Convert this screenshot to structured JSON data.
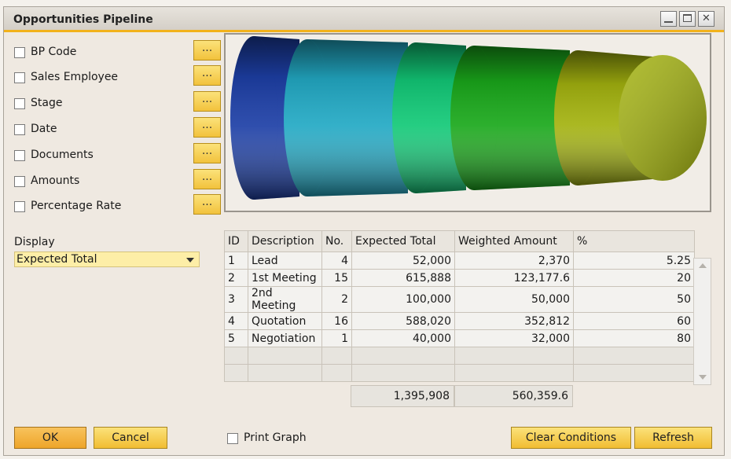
{
  "window": {
    "title": "Opportunities Pipeline"
  },
  "criteria": [
    {
      "label": "BP Code",
      "checked": false
    },
    {
      "label": "Sales Employee",
      "checked": false
    },
    {
      "label": "Stage",
      "checked": false
    },
    {
      "label": "Date",
      "checked": false
    },
    {
      "label": "Documents",
      "checked": false
    },
    {
      "label": "Amounts",
      "checked": false
    },
    {
      "label": "Percentage Rate",
      "checked": false
    }
  ],
  "criteria_button_label": "...",
  "display": {
    "label": "Display",
    "value": "Expected Total"
  },
  "graph": {
    "segment_colors": [
      "#1d3fa6",
      "#22a9c4",
      "#12c977",
      "#1aa81b",
      "#a3b20f"
    ]
  },
  "table": {
    "headers": [
      "ID",
      "Description",
      "No.",
      "Expected Total",
      "Weighted Amount",
      "%"
    ],
    "rows": [
      [
        "1",
        "Lead",
        "4",
        "52,000",
        "2,370",
        "5.25"
      ],
      [
        "2",
        "1st Meeting",
        "15",
        "615,888",
        "123,177.6",
        "20"
      ],
      [
        "3",
        "2nd Meeting",
        "2",
        "100,000",
        "50,000",
        "50"
      ],
      [
        "4",
        "Quotation",
        "16",
        "588,020",
        "352,812",
        "60"
      ],
      [
        "5",
        "Negotiation",
        "1",
        "40,000",
        "32,000",
        "80"
      ]
    ],
    "totals": {
      "expected_total": "1,395,908",
      "weighted_amount": "560,359.6"
    }
  },
  "buttons": {
    "ok": "OK",
    "cancel": "Cancel",
    "clear_conditions": "Clear Conditions",
    "refresh": "Refresh"
  },
  "print_graph": {
    "label": "Print Graph",
    "checked": false
  }
}
